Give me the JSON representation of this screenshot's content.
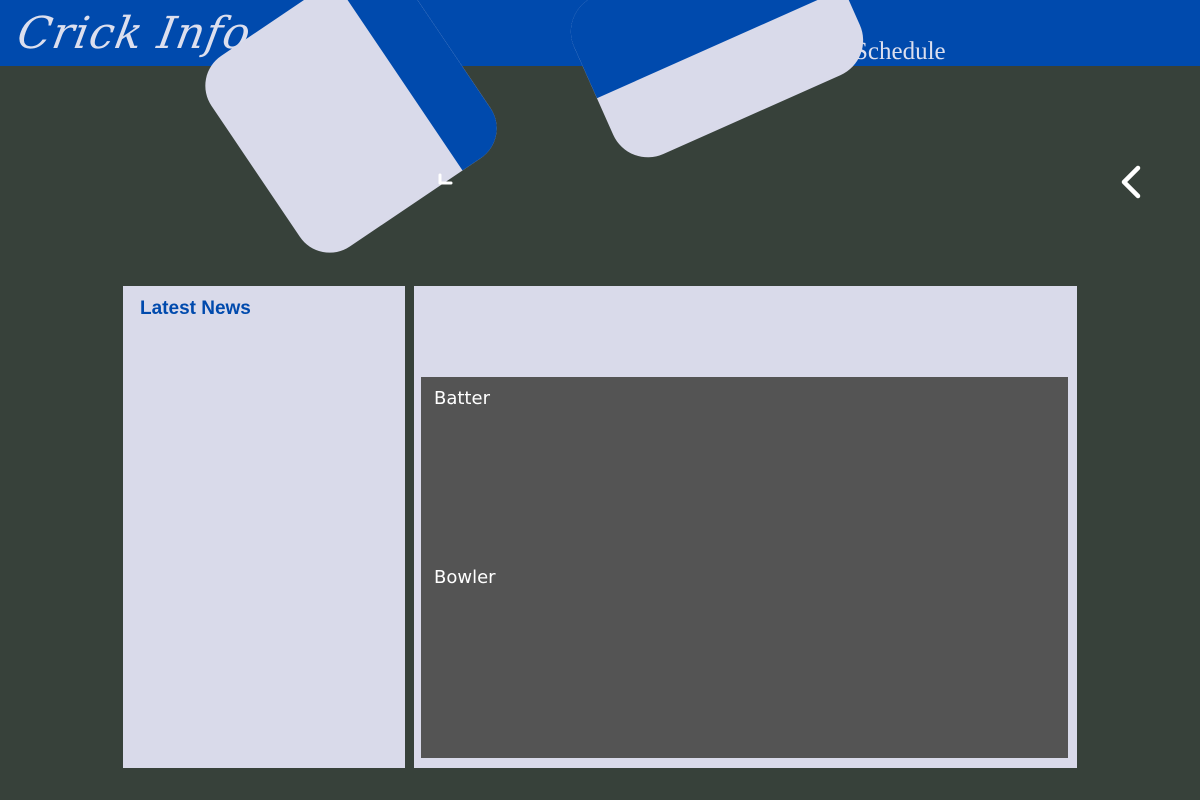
{
  "header": {
    "logo_text": "Crick Info",
    "nav": {
      "schedule_label": "Schedule"
    }
  },
  "icons": {
    "carousel_prev": "chevron-left-icon",
    "card_toggle": "chevron-down-icon"
  },
  "news": {
    "title": "Latest News"
  },
  "scorecard": {
    "batter_label": "Batter",
    "bowler_label": "Bowler"
  },
  "colors": {
    "brand_blue": "#004aad",
    "page_background": "#37413a",
    "panel_background": "#d9daea",
    "scorecard_background": "#545454"
  }
}
